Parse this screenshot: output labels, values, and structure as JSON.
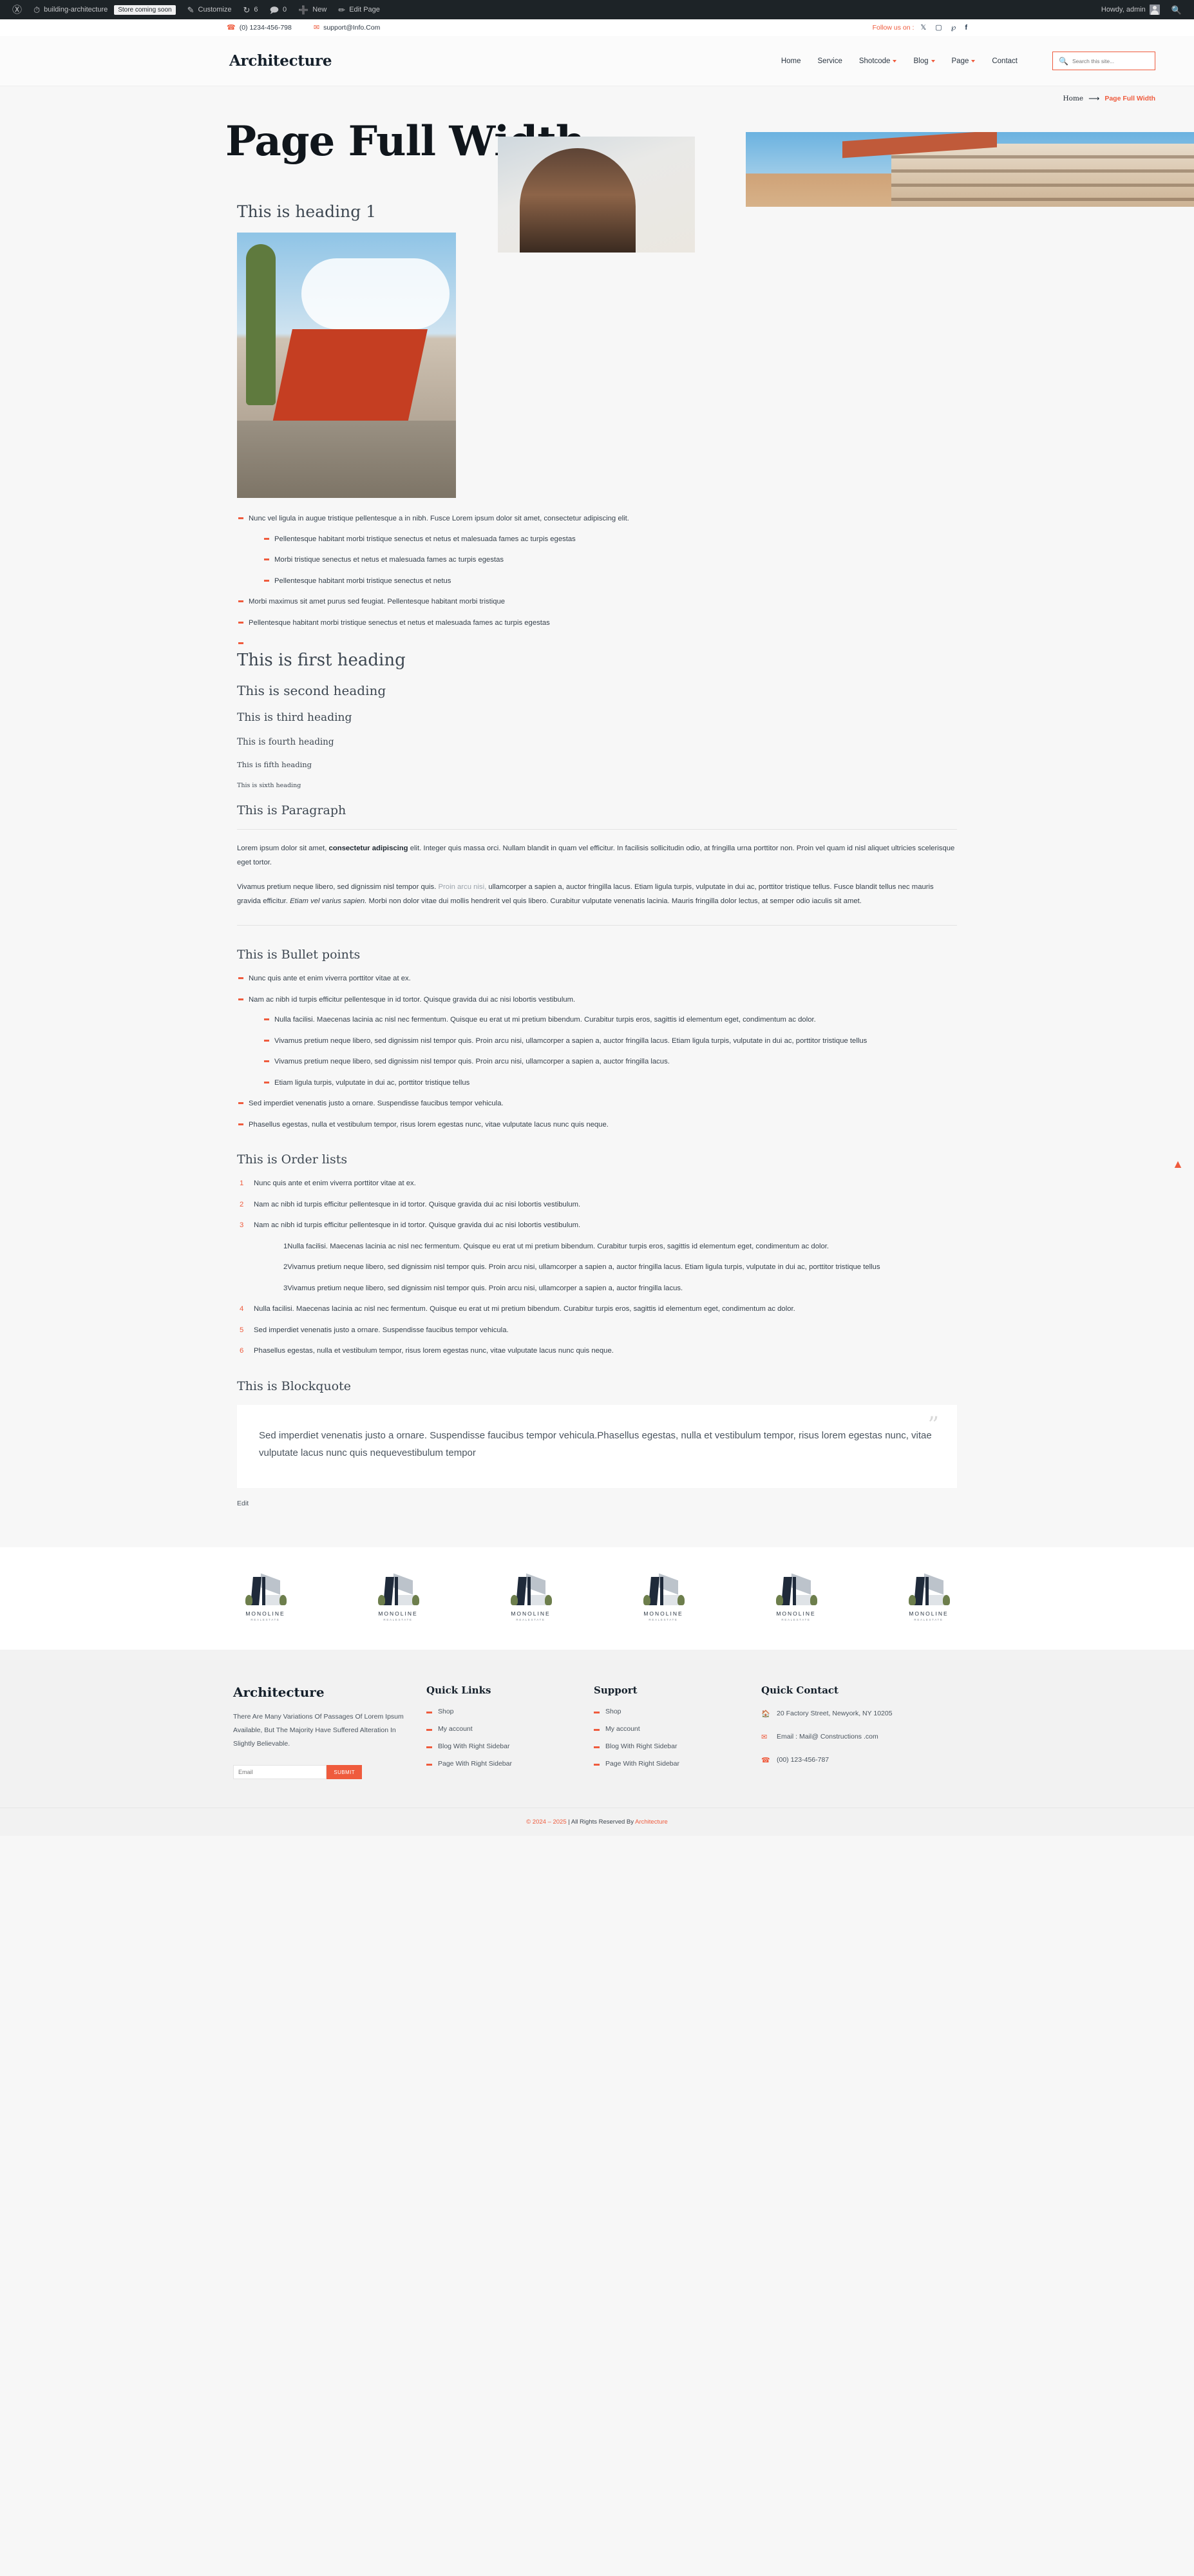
{
  "admin_bar": {
    "site_name": "building-architecture",
    "store_badge": "Store coming soon",
    "customize": "Customize",
    "updates_count": "6",
    "comments_count": "0",
    "new": "New",
    "edit_page": "Edit Page",
    "howdy": "Howdy, admin"
  },
  "topbar": {
    "phone": "(0) 1234-456-798",
    "email": "support@Info.Com",
    "follow_label": "Follow us on :",
    "social": [
      "X",
      "Instagram",
      "Pinterest",
      "Facebook"
    ]
  },
  "header": {
    "brand": "Architecture",
    "nav": [
      {
        "label": "Home",
        "caret": false
      },
      {
        "label": "Service",
        "caret": false
      },
      {
        "label": "Shotcode",
        "caret": true
      },
      {
        "label": "Blog",
        "caret": true
      },
      {
        "label": "Page",
        "caret": true
      },
      {
        "label": "Contact",
        "caret": false
      }
    ],
    "search_placeholder": "Search this site...",
    "search_value": ""
  },
  "hero": {
    "title": "Page Full Width",
    "breadcrumb_home": "Home",
    "breadcrumb_current": "Page Full Width"
  },
  "sections": {
    "heading1": "This is heading 1",
    "first_list": [
      {
        "text": "Nunc vel ligula in augue tristique pellentesque a in nibh. Fusce Lorem ipsum dolor sit amet, consectetur adipiscing elit.",
        "children": [
          "Pellentesque habitant morbi tristique senectus et netus et malesuada fames ac turpis egestas",
          "Morbi tristique senectus et netus et malesuada fames ac turpis egestas",
          "Pellentesque habitant morbi tristique senectus et netus"
        ]
      },
      {
        "text": "Morbi maximus sit amet purus sed feugiat. Pellentesque habitant morbi tristique",
        "children": []
      },
      {
        "text": "Pellentesque habitant morbi tristique senectus et netus et malesuada fames ac turpis egestas",
        "children": []
      },
      {
        "text": "",
        "children": []
      }
    ],
    "headings": [
      "This is first heading",
      "This is second heading",
      "This is third heading",
      "This is fourth heading",
      "This is fifth heading",
      "This is sixth heading"
    ],
    "paragraph_title": "This is Paragraph",
    "paragraph_1_a": "Lorem ipsum dolor sit amet, ",
    "paragraph_1_b": "consectetur adipiscing",
    "paragraph_1_c": " elit. Integer quis massa orci. Nullam blandit in quam vel efficitur. In facilisis sollicitudin odio, at fringilla urna porttitor non. Proin vel quam id nisl aliquet ultricies scelerisque eget tortor.",
    "paragraph_2_a": "Vivamus pretium neque libero, sed dignissim nisl tempor quis. ",
    "paragraph_2_b": "Proin arcu nisi,",
    "paragraph_2_c": " ullamcorper a sapien a, auctor fringilla lacus. Etiam ligula turpis, vulputate in dui ac, porttitor tristique tellus. Fusce blandit tellus nec mauris gravida efficitur. ",
    "paragraph_2_d": "Etiam vel varius sapien.",
    "paragraph_2_e": " Morbi non dolor vitae dui mollis hendrerit vel quis libero. Curabitur vulputate venenatis lacinia. Mauris fringilla dolor lectus, at semper odio iaculis sit amet.",
    "bullets_title": "This is Bullet points",
    "bullets": [
      {
        "text": "Nunc quis ante et enim viverra porttitor vitae at ex.",
        "children": []
      },
      {
        "text": "Nam ac nibh id turpis efficitur pellentesque in id tortor. Quisque gravida dui ac nisi lobortis vestibulum.",
        "children": [
          "Nulla facilisi. Maecenas lacinia ac nisl nec fermentum. Quisque eu erat ut mi pretium bibendum. Curabitur turpis eros, sagittis id elementum eget, condimentum ac dolor.",
          "Vivamus pretium neque libero, sed dignissim nisl tempor quis. Proin arcu nisi, ullamcorper a sapien a, auctor fringilla lacus. Etiam ligula turpis, vulputate in dui ac, porttitor tristique tellus",
          "Vivamus pretium neque libero, sed dignissim nisl tempor quis. Proin arcu nisi, ullamcorper a sapien a, auctor fringilla lacus.",
          "Etiam ligula turpis, vulputate in dui ac, porttitor tristique tellus"
        ]
      },
      {
        "text": "Sed imperdiet venenatis justo a ornare. Suspendisse faucibus tempor vehicula.",
        "children": []
      },
      {
        "text": "Phasellus egestas, nulla et vestibulum tempor, risus lorem egestas nunc, vitae vulputate lacus nunc quis neque.",
        "children": []
      }
    ],
    "orders_title": "This is Order lists",
    "orders": [
      {
        "text": "Nunc quis ante et enim viverra porttitor vitae at ex.",
        "children": []
      },
      {
        "text": "Nam ac nibh id turpis efficitur pellentesque in id tortor. Quisque gravida dui ac nisi lobortis vestibulum.",
        "children": []
      },
      {
        "text": "Nam ac nibh id turpis efficitur pellentesque in id tortor. Quisque gravida dui ac nisi lobortis vestibulum.",
        "children": [
          "Nulla facilisi. Maecenas lacinia ac nisl nec fermentum. Quisque eu erat ut mi pretium bibendum. Curabitur turpis eros, sagittis id elementum eget, condimentum ac dolor.",
          "Vivamus pretium neque libero, sed dignissim nisl tempor quis. Proin arcu nisi, ullamcorper a sapien a, auctor fringilla lacus. Etiam ligula turpis, vulputate in dui ac, porttitor tristique tellus",
          "Vivamus pretium neque libero, sed dignissim nisl tempor quis. Proin arcu nisi, ullamcorper a sapien a, auctor fringilla lacus."
        ]
      },
      {
        "text": "Nulla facilisi. Maecenas lacinia ac nisl nec fermentum. Quisque eu erat ut mi pretium bibendum. Curabitur turpis eros, sagittis id elementum eget, condimentum ac dolor.",
        "children": []
      },
      {
        "text": "Sed imperdiet venenatis justo a ornare. Suspendisse faucibus tempor vehicula.",
        "children": []
      },
      {
        "text": "Phasellus egestas, nulla et vestibulum tempor, risus lorem egestas nunc, vitae vulputate lacus nunc quis neque.",
        "children": []
      }
    ],
    "blockquote_title": "This is Blockquote",
    "blockquote_text": "Sed imperdiet venenatis justo a ornare. Suspendisse faucibus tempor vehicula.Phasellus egestas, nulla et vestibulum tempor, risus lorem egestas nunc, vitae vulputate lacus nunc quis nequevestibulum tempor",
    "edit_label": "Edit"
  },
  "logos": [
    {
      "name": "MONOLINE",
      "sub": "REALESTATE"
    },
    {
      "name": "MONOLINE",
      "sub": "REALESTATE"
    },
    {
      "name": "MONOLINE",
      "sub": "REALESTATE"
    },
    {
      "name": "MONOLINE",
      "sub": "REALESTATE"
    },
    {
      "name": "MONOLINE",
      "sub": "REALESTATE"
    },
    {
      "name": "MONOLINE",
      "sub": "REALESTATE"
    }
  ],
  "footer": {
    "brand": "Architecture",
    "description": "There Are Many Variations Of Passages Of Lorem Ipsum Available, But The Majority Have Suffered Alteration In Slightly Believable.",
    "email_placeholder": "Email",
    "email_value": "",
    "submit_label": "SUBMIT",
    "quick_links_title": "Quick Links",
    "quick_links": [
      "Shop",
      "My account",
      "Blog With Right Sidebar",
      "Page With Right Sidebar"
    ],
    "support_title": "Support",
    "support_links": [
      "Shop",
      "My account",
      "Blog With Right Sidebar",
      "Page With Right Sidebar"
    ],
    "contact_title": "Quick Contact",
    "address": "20 Factory Street, Newyork, NY 10205",
    "email_line": "Email : Mail@ Constructions .com",
    "phone": "(00) 123-456-787",
    "copyright_year": "© 2024 – 2025",
    "copyright_sep": " | All Rights Reserved By ",
    "copyright_brand": "Architecture"
  },
  "colors": {
    "accent": "#ef5b3d",
    "dark": "#15202b",
    "admin_bar": "#1d2327",
    "page_bg": "#f7f7f7"
  }
}
